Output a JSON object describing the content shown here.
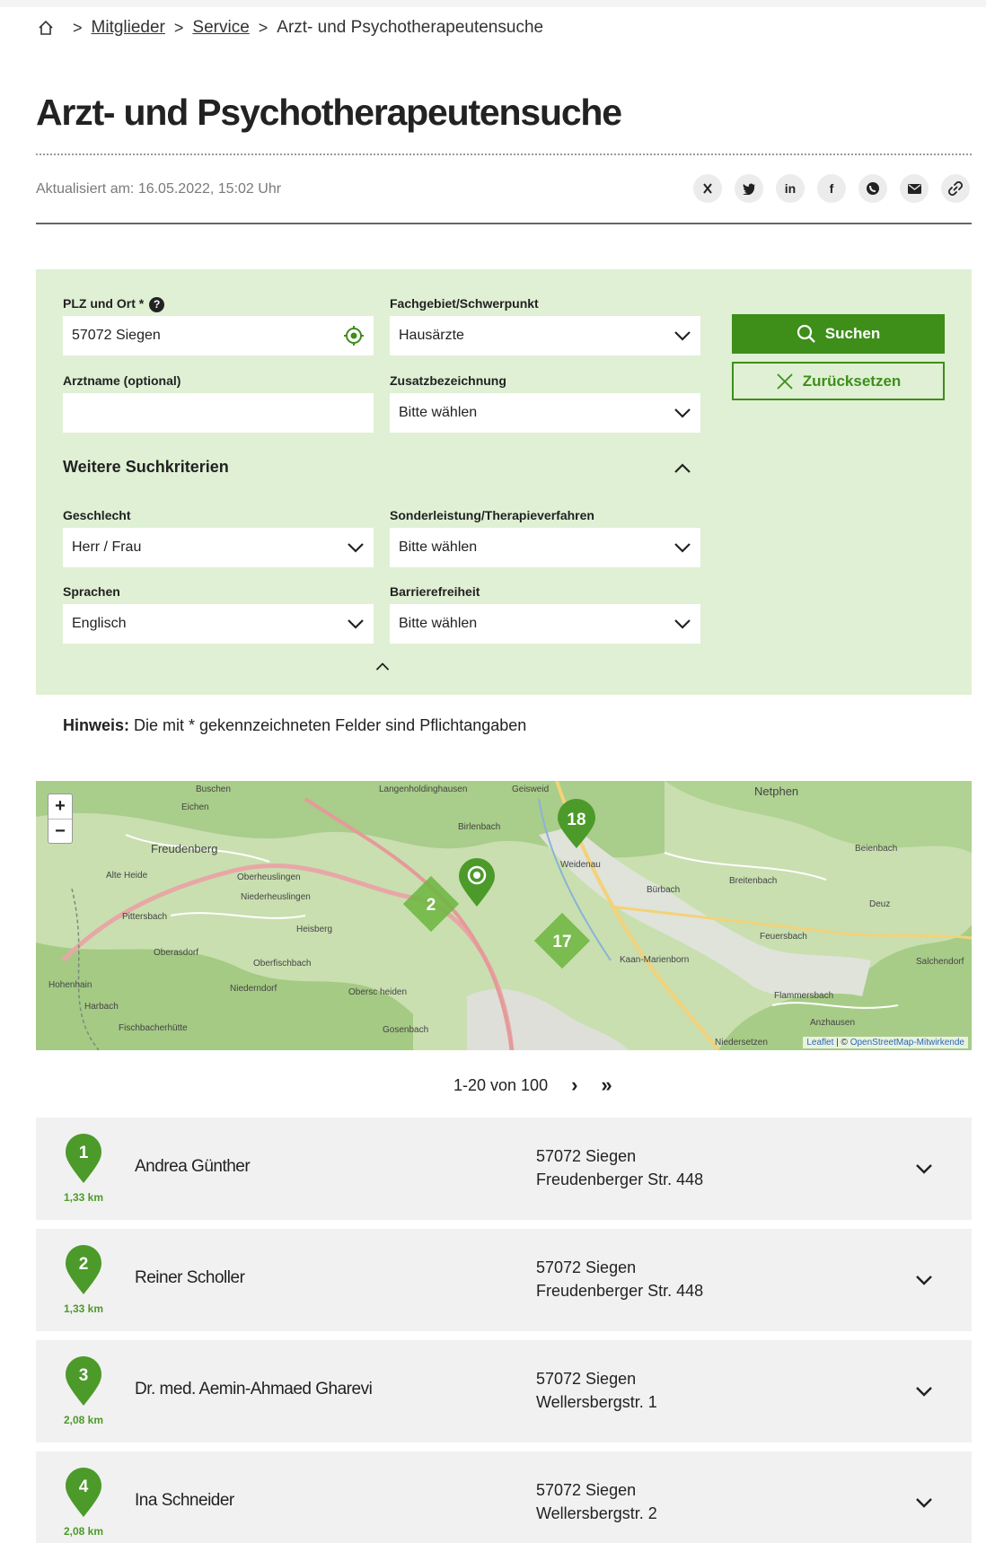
{
  "breadcrumb": {
    "items": [
      "Mitglieder",
      "Service"
    ],
    "current": "Arzt- und Psychotherapeutensuche"
  },
  "page": {
    "title": "Arzt- und Psychotherapeutensuche",
    "updated": "Aktualisiert am: 16.05.2022, 15:02 Uhr"
  },
  "share": [
    "X",
    "t",
    "in",
    "f",
    "w",
    "m",
    "l"
  ],
  "search": {
    "plz_label": "PLZ und Ort *",
    "plz_value": "57072 Siegen",
    "fachgebiet_label": "Fachgebiet/Schwerpunkt",
    "fachgebiet_value": "Hausärzte",
    "arztname_label": "Arztname (optional)",
    "arztname_value": "",
    "zusatz_label": "Zusatzbezeichnung",
    "zusatz_value": "Bitte wählen",
    "search_button": "Suchen",
    "reset_button": "Zurücksetzen",
    "more_title": "Weitere Suchkriterien",
    "geschlecht_label": "Geschlecht",
    "geschlecht_value": "Herr / Frau",
    "sonder_label": "Sonderleistung/Therapieverfahren",
    "sonder_value": "Bitte wählen",
    "sprachen_label": "Sprachen",
    "sprachen_value": "Englisch",
    "barriere_label": "Barrierefreiheit",
    "barriere_value": "Bitte wählen"
  },
  "hint": {
    "prefix": "Hinweis:",
    "text": " Die mit * gekennzeichneten Felder sind Pflichtangaben"
  },
  "map": {
    "zoom_in": "+",
    "zoom_out": "−",
    "attribution_leaflet": "Leaflet",
    "attribution_sep": " | © ",
    "attribution_osm": "OpenStreetMap-Mitwirkende",
    "clusters": [
      "18",
      "2",
      "17"
    ],
    "places": [
      "Buschen",
      "Eichen",
      "Freudenberg",
      "Alte Heide",
      "Oberheuslingen",
      "Niederheuslingen",
      "Pittersbach",
      "Oberasdorf",
      "Oberfischbach",
      "Niederndorf",
      "Hohenhain",
      "Heisberg",
      "Langenholdinghausen",
      "Geisweid",
      "Birlenbach",
      "Weidenau",
      "Netphen",
      "Bürbach",
      "Kaan-Marienborn",
      "Feuersbach",
      "Obersc heiden",
      "Gosenbach",
      "Niedersetzen",
      "Deuz",
      "Salchendorf",
      "Flammersbach",
      "Anzhausen",
      "Beienbach",
      "Breitenbach",
      "Fischbacherhütte",
      "Harbach"
    ]
  },
  "pager": {
    "range": "1-20 von 100",
    "next": "›",
    "last": "»"
  },
  "results": [
    {
      "num": "1",
      "dist": "1,33 km",
      "name": "Andrea Günther",
      "city": "57072 Siegen",
      "street": "Freudenberger Str. 448"
    },
    {
      "num": "2",
      "dist": "1,33 km",
      "name": "Reiner Scholler",
      "city": "57072 Siegen",
      "street": "Freudenberger Str. 448"
    },
    {
      "num": "3",
      "dist": "2,08 km",
      "name": "Dr. med. Aemin-Ahmaed Gharevi",
      "city": "57072 Siegen",
      "street": "Wellersbergstr. 1"
    },
    {
      "num": "4",
      "dist": "2,08 km",
      "name": "Ina Schneider",
      "city": "57072 Siegen",
      "street": "Wellersbergstr. 2"
    }
  ],
  "colors": {
    "accent": "#3e8e1a",
    "panel": "#dff0d4",
    "row": "#f1f1f1",
    "pin": "#4c9a2a"
  }
}
